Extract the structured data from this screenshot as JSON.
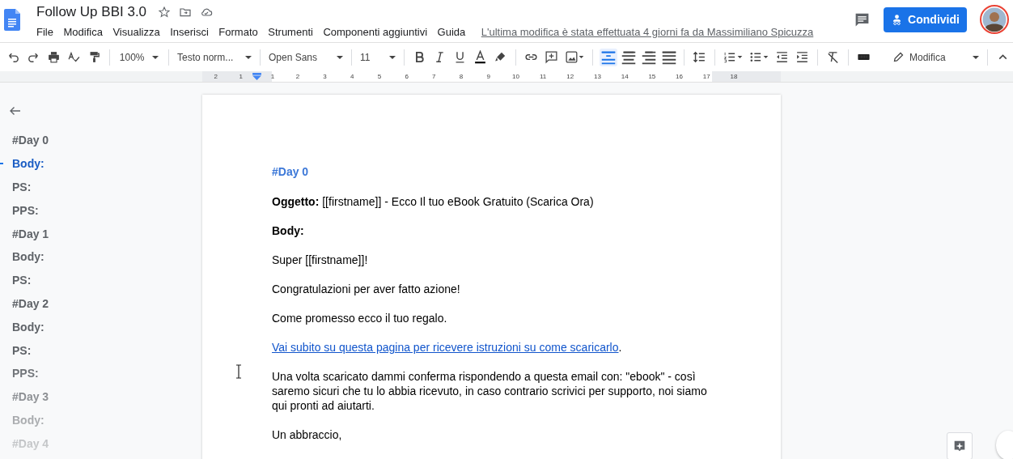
{
  "window": {
    "title": "Follow Up BBI 3.0"
  },
  "menu": [
    "File",
    "Modifica",
    "Visualizza",
    "Inserisci",
    "Formato",
    "Strumenti",
    "Componenti aggiuntivi",
    "Guida"
  ],
  "last_edit": "L'ultima modifica è stata effettuata 4 giorni fa da Massimiliano Spicuzza",
  "share_button": "Condividi",
  "toolbar": {
    "zoom": "100%",
    "style": "Testo norm...",
    "font": "Open Sans",
    "size": "11",
    "mode": "Modifica",
    "alignment": [
      {
        "selected": true
      },
      {
        "selected": false
      },
      {
        "selected": false
      },
      {
        "selected": false
      }
    ]
  },
  "ruler": [
    "2",
    "1",
    "1",
    "2",
    "3",
    "4",
    "5",
    "6",
    "7",
    "8",
    "9",
    "10",
    "11",
    "12",
    "13",
    "14",
    "15",
    "16",
    "17",
    "18"
  ],
  "outline": [
    {
      "label": "#Day 0",
      "selected": false
    },
    {
      "label": "Body:",
      "selected": true
    },
    {
      "label": "PS:",
      "selected": false
    },
    {
      "label": "PPS:",
      "selected": false
    },
    {
      "label": "#Day 1",
      "selected": false
    },
    {
      "label": "Body:",
      "selected": false
    },
    {
      "label": "PS:",
      "selected": false
    },
    {
      "label": "#Day 2",
      "selected": false
    },
    {
      "label": "Body:",
      "selected": false
    },
    {
      "label": "PS:",
      "selected": false
    },
    {
      "label": "PPS:",
      "selected": false
    },
    {
      "label": "#Day 3",
      "selected": false
    },
    {
      "label": "Body:",
      "selected": false
    },
    {
      "label": "#Day 4",
      "selected": false
    }
  ],
  "document": [
    {
      "kind": "heading",
      "text": "#Day 0"
    },
    {
      "kind": "text",
      "text": "**Oggetto:** [[firstname]] - Ecco Il tuo eBook Gratuito (Scarica Ora)"
    },
    {
      "kind": "bold",
      "text": "Body:"
    },
    {
      "kind": "text",
      "text": "Super [[firstname]]!"
    },
    {
      "kind": "text",
      "text": "Congratulazioni per aver fatto azione!"
    },
    {
      "kind": "text",
      "text": "Come promesso ecco il tuo regalo."
    },
    {
      "kind": "link",
      "text": "Vai subito su questa pagina per ricevere istruzioni su come scaricarlo",
      "after": "."
    },
    {
      "kind": "text",
      "text": "Una volta scaricato dammi conferma rispondendo a questa email con: \"ebook\" - così saremo sicuri che tu lo abbia ricevuto, in caso contrario scrivici per supporto, noi siamo qui pronti ad aiutarti."
    },
    {
      "kind": "text",
      "text": "Un abbraccio,"
    }
  ]
}
